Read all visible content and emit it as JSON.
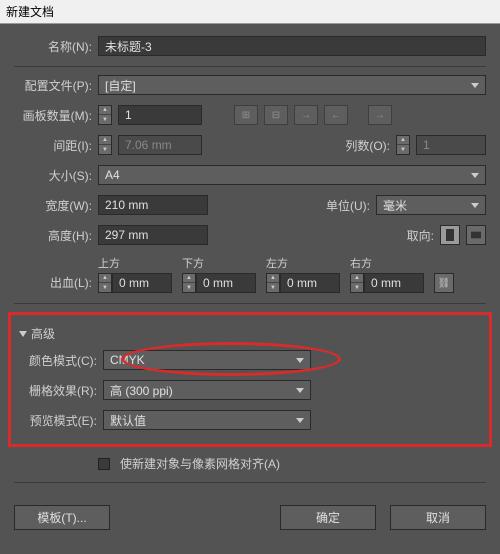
{
  "title": "新建文档",
  "name": {
    "label": "名称(N):",
    "value": "未标题-3"
  },
  "profile": {
    "label": "配置文件(P):",
    "value": "[自定]"
  },
  "artboards": {
    "label": "画板数量(M):",
    "value": "1"
  },
  "spacing": {
    "label": "间距(I):",
    "value": "7.06 mm"
  },
  "columns": {
    "label": "列数(O):",
    "value": "1"
  },
  "size": {
    "label": "大小(S):",
    "value": "A4"
  },
  "width": {
    "label": "宽度(W):",
    "value": "210 mm"
  },
  "height": {
    "label": "高度(H):",
    "value": "297 mm"
  },
  "units": {
    "label": "单位(U):",
    "value": "毫米"
  },
  "orient": {
    "label": "取向:"
  },
  "bleed": {
    "label": "出血(L):",
    "top": {
      "h": "上方",
      "v": "0 mm"
    },
    "bottom": {
      "h": "下方",
      "v": "0 mm"
    },
    "left": {
      "h": "左方",
      "v": "0 mm"
    },
    "right": {
      "h": "右方",
      "v": "0 mm"
    }
  },
  "advanced": {
    "label": "高级",
    "color": {
      "label": "颜色模式(C):",
      "value": "CMYK"
    },
    "raster": {
      "label": "栅格效果(R):",
      "value": "高 (300 ppi)"
    },
    "preview": {
      "label": "预览模式(E):",
      "value": "默认值"
    }
  },
  "align_pixel": "使新建对象与像素网格对齐(A)",
  "buttons": {
    "template": "模板(T)...",
    "ok": "确定",
    "cancel": "取消"
  }
}
